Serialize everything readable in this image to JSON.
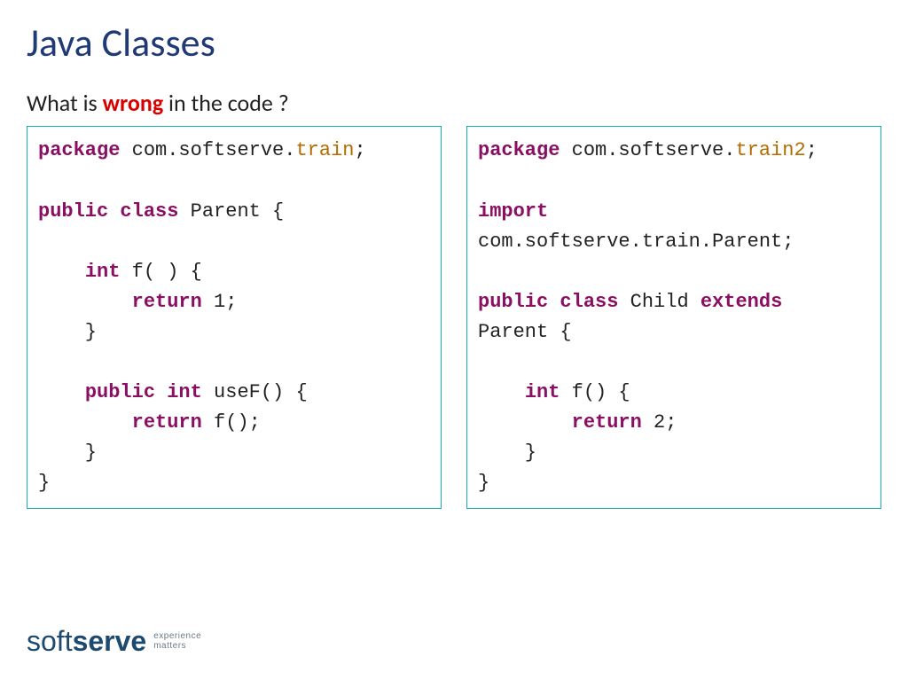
{
  "title": "Java Classes",
  "prompt_before": "What is ",
  "prompt_wrong": "wrong",
  "prompt_after": " in the code ?",
  "left_code_tokens": [
    {
      "t": "kw",
      "v": "package"
    },
    {
      "t": "",
      "v": " com.softserve."
    },
    {
      "t": "cls",
      "v": "train"
    },
    {
      "t": "",
      "v": ";\n\n"
    },
    {
      "t": "kw",
      "v": "public"
    },
    {
      "t": "",
      "v": " "
    },
    {
      "t": "kw",
      "v": "class"
    },
    {
      "t": "",
      "v": " Parent {\n\n    "
    },
    {
      "t": "kw",
      "v": "int"
    },
    {
      "t": "",
      "v": " f( ) {\n        "
    },
    {
      "t": "ret",
      "v": "return"
    },
    {
      "t": "",
      "v": " 1;\n    }\n\n    "
    },
    {
      "t": "kw",
      "v": "public"
    },
    {
      "t": "",
      "v": " "
    },
    {
      "t": "kw",
      "v": "int"
    },
    {
      "t": "",
      "v": " useF() {\n        "
    },
    {
      "t": "ret",
      "v": "return"
    },
    {
      "t": "",
      "v": " f();\n    }\n}"
    }
  ],
  "right_code_tokens": [
    {
      "t": "kw",
      "v": "package"
    },
    {
      "t": "",
      "v": " com.softserve."
    },
    {
      "t": "cls",
      "v": "train2"
    },
    {
      "t": "",
      "v": ";\n\n"
    },
    {
      "t": "kw",
      "v": "import"
    },
    {
      "t": "",
      "v": "\ncom.softserve.train.Parent;\n\n"
    },
    {
      "t": "kw",
      "v": "public"
    },
    {
      "t": "",
      "v": " "
    },
    {
      "t": "kw",
      "v": "class"
    },
    {
      "t": "",
      "v": " Child "
    },
    {
      "t": "kw",
      "v": "extends"
    },
    {
      "t": "",
      "v": "\nParent {\n\n    "
    },
    {
      "t": "kw",
      "v": "int"
    },
    {
      "t": "",
      "v": " f() {\n        "
    },
    {
      "t": "ret",
      "v": "return"
    },
    {
      "t": "",
      "v": " 2;\n    }\n}"
    }
  ],
  "logo": {
    "soft": "soft",
    "serve": "serve",
    "tag1": "experience",
    "tag2": "matters"
  }
}
